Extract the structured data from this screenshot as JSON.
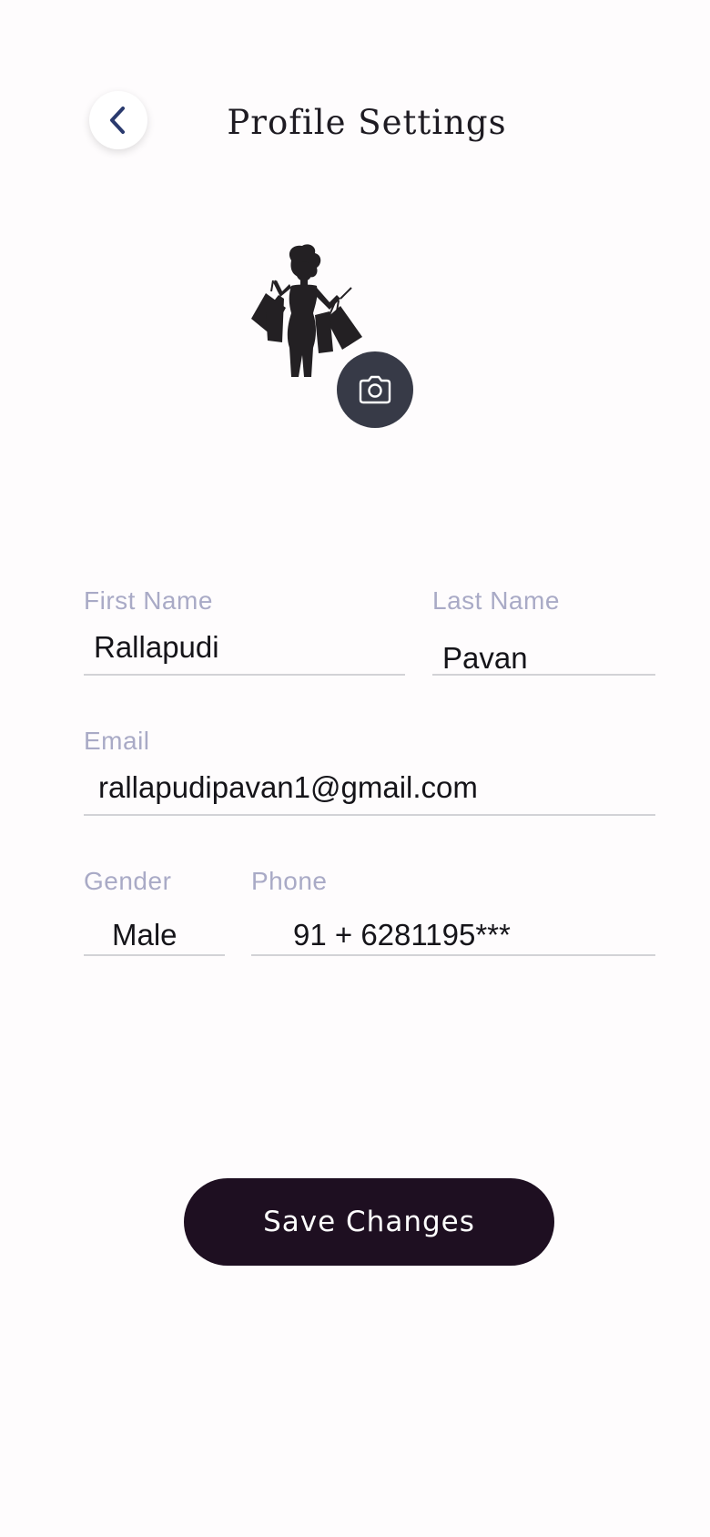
{
  "header": {
    "title": "Profile Settings",
    "back_icon": "chevron-left-icon"
  },
  "avatar": {
    "image": "shopping-woman-silhouette",
    "camera_icon": "camera-icon"
  },
  "form": {
    "first_name": {
      "label": "First Name",
      "value": "Rallapudi"
    },
    "last_name": {
      "label": "Last Name",
      "value": "Pavan"
    },
    "email": {
      "label": "Email",
      "value": "rallapudipavan1@gmail.com"
    },
    "gender": {
      "label": "Gender",
      "value": "Male"
    },
    "phone": {
      "label": "Phone",
      "value": "91 + 6281195***"
    }
  },
  "save_button": {
    "label": "Save Changes"
  },
  "colors": {
    "background": "#fefcfd",
    "label": "#a9aac6",
    "button": "#1e0f21",
    "camera_button": "#373a47",
    "back_icon": "#2a3a6e"
  }
}
